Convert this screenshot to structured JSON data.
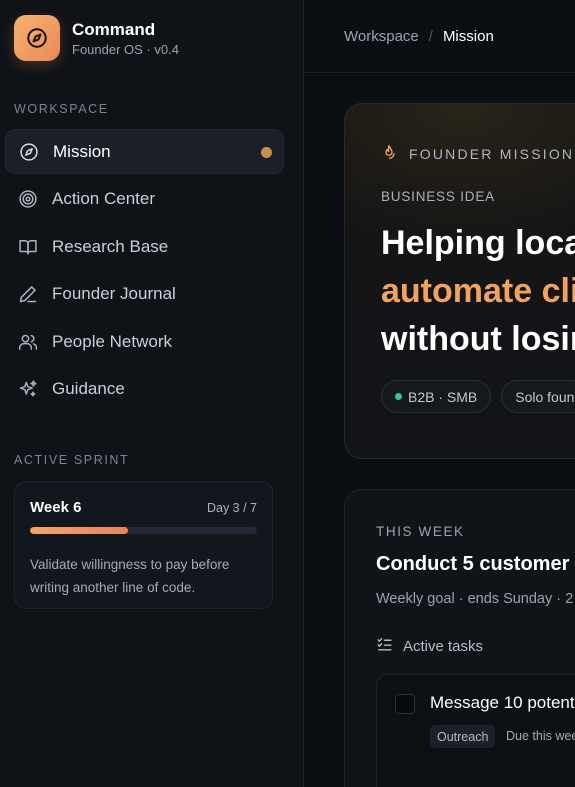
{
  "brand": {
    "title": "Command",
    "subtitle": "Founder OS · v0.4"
  },
  "sidebar": {
    "workspace_label": "WORKSPACE",
    "items": [
      {
        "label": "Mission",
        "icon": "compass-icon",
        "active": true
      },
      {
        "label": "Action Center",
        "icon": "target-icon"
      },
      {
        "label": "Research Base",
        "icon": "book-icon"
      },
      {
        "label": "Founder Journal",
        "icon": "pen-icon"
      },
      {
        "label": "People Network",
        "icon": "users-icon"
      },
      {
        "label": "Guidance",
        "icon": "sparkles-icon"
      }
    ],
    "sprint_label": "ACTIVE SPRINT",
    "sprint": {
      "week": "Week 6",
      "day": "Day 3 / 7",
      "progress": 0.43,
      "note": "Validate willingness to pay before writing another line of code."
    }
  },
  "breadcrumb": {
    "parent": "Workspace",
    "separator": "/",
    "current": "Mission"
  },
  "mission": {
    "tag": "FOUNDER MISSION ·",
    "idea_label": "BUSINESS IDEA",
    "headline_line1": "Helping local",
    "headline_line2": "automate clie",
    "headline_line3": "without losin",
    "chips": [
      "B2B · SMB",
      "Solo foun"
    ]
  },
  "week": {
    "label": "THIS WEEK",
    "goal": "Conduct 5 customer",
    "meta": "Weekly goal · ends Sunday · 2",
    "tasks_label": "Active tasks",
    "task": {
      "title": "Message 10 potent",
      "tag": "Outreach",
      "due": "Due this wee"
    }
  },
  "colors": {
    "accent": "#f0a35f",
    "active_dot": "#c8904f",
    "chip_dot": "#3ec28f"
  }
}
